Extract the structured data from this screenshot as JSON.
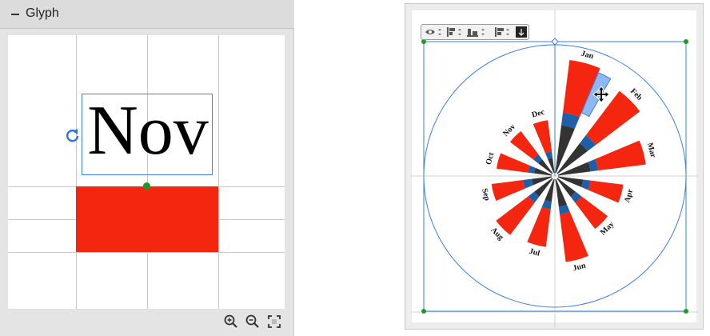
{
  "glyph_panel": {
    "title": "Glyph",
    "glyph_text": "Nov",
    "glyph_color": "#000000",
    "fill_color": "#f4260f",
    "selection_color": "#3d7ee0",
    "icons": {
      "collapse": "minus-icon",
      "rotate": "rotate-icon",
      "zoom_in": "zoom-in-icon",
      "zoom_out": "zoom-out-icon",
      "fit": "fit-screen-icon"
    }
  },
  "chart_editor": {
    "toolbar": {
      "buttons": [
        "visibility-dropdown",
        "align-top-dropdown",
        "align-bottom-dropdown",
        "align-left-dropdown",
        "anchor-button"
      ]
    },
    "selection_color": "#3d7ee0",
    "handle_color": "#1a9a2a"
  },
  "chart_data": {
    "type": "radial-bar",
    "categories": [
      "Jan",
      "Feb",
      "Mar",
      "Apr",
      "May",
      "Jun",
      "Jul",
      "Aug",
      "Sep",
      "Oct",
      "Nov",
      "Dec"
    ],
    "selected_category": "Jan",
    "series": [
      {
        "values": [
          0.38,
          0.3,
          0.26,
          0.2,
          0.18,
          0.22,
          0.18,
          0.18,
          0.16,
          0.14,
          0.14,
          0.12
        ]
      },
      {
        "values": [
          0.1,
          0.08,
          0.06,
          0.06,
          0.06,
          0.06,
          0.06,
          0.06,
          0.07,
          0.05,
          0.05,
          0.05
        ]
      },
      {
        "values": [
          0.9,
          0.82,
          0.7,
          0.52,
          0.5,
          0.66,
          0.54,
          0.56,
          0.48,
          0.44,
          0.42,
          0.42
        ]
      }
    ],
    "colors": {
      "outer": "#f4260f",
      "middle": "#1f5fa8",
      "inner": "#333333",
      "selected_outer": "#8fb8f2"
    }
  }
}
